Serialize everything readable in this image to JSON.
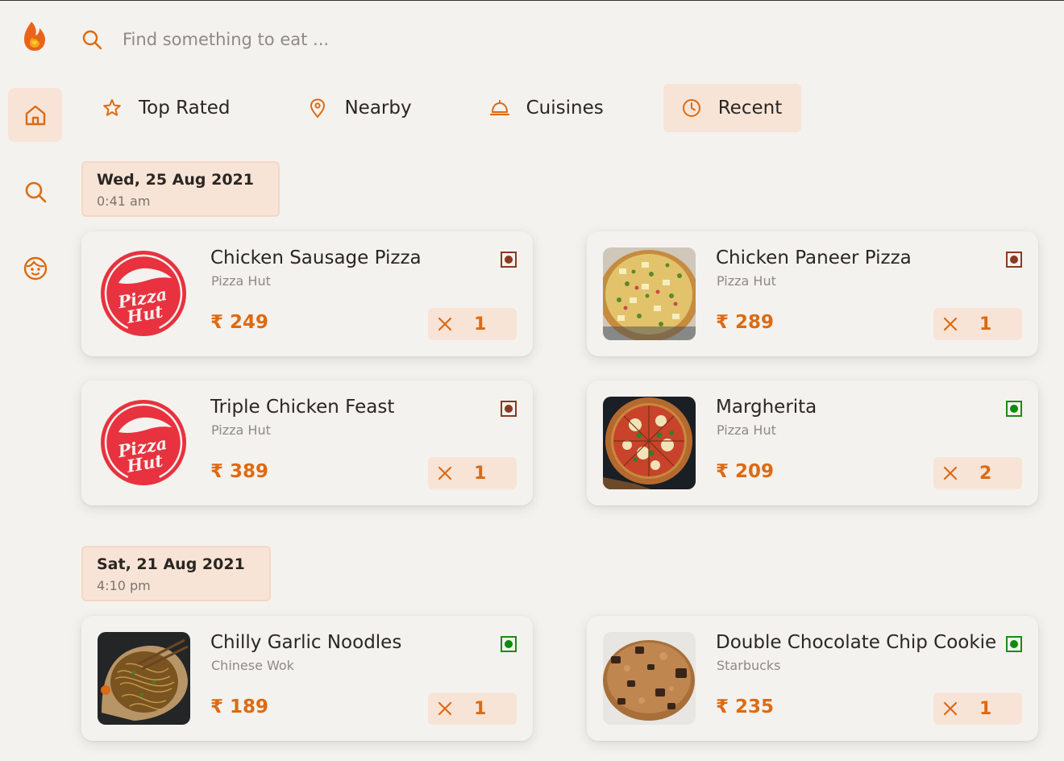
{
  "search": {
    "placeholder": "Find something to eat ..."
  },
  "tabs": [
    {
      "label": "Top Rated",
      "icon": "star-icon"
    },
    {
      "label": "Nearby",
      "icon": "location-pin-icon"
    },
    {
      "label": "Cuisines",
      "icon": "cloche-icon"
    },
    {
      "label": "Recent",
      "icon": "clock-icon",
      "active": true
    }
  ],
  "sidebar": [
    {
      "icon": "home-icon",
      "active": true
    },
    {
      "icon": "search-icon"
    },
    {
      "icon": "face-icon"
    }
  ],
  "currency": "₹",
  "groups": [
    {
      "date": "Wed, 25 Aug 2021",
      "time": "0:41 am",
      "items": [
        {
          "name": "Chicken Sausage Pizza",
          "restaurant": "Pizza Hut",
          "price": "₹ 249",
          "qty": "1",
          "veg": false,
          "image": "pizza-hut-logo"
        },
        {
          "name": "Chicken Paneer Pizza",
          "restaurant": "Pizza Hut",
          "price": "₹ 289",
          "qty": "1",
          "veg": false,
          "image": "paneer-pizza-photo"
        },
        {
          "name": "Triple Chicken Feast",
          "restaurant": "Pizza Hut",
          "price": "₹ 389",
          "qty": "1",
          "veg": false,
          "image": "pizza-hut-logo"
        },
        {
          "name": "Margherita",
          "restaurant": "Pizza Hut",
          "price": "₹ 209",
          "qty": "2",
          "veg": true,
          "image": "margherita-photo"
        }
      ]
    },
    {
      "date": "Sat, 21 Aug 2021",
      "time": "4:10 pm",
      "items": [
        {
          "name": "Chilly Garlic Noodles",
          "restaurant": "Chinese Wok",
          "price": "₹ 189",
          "qty": "1",
          "veg": true,
          "image": "noodles-photo"
        },
        {
          "name": "Double Chocolate Chip Cookie",
          "restaurant": "Starbucks",
          "price": "₹ 235",
          "qty": "1",
          "veg": true,
          "image": "cookie-photo"
        }
      ]
    }
  ],
  "colors": {
    "accent": "#dd6a12",
    "accent_soft": "#f8e4d7",
    "background": "#f4f2ee",
    "nonveg": "#8a3a22",
    "veg": "#0f8a0f"
  }
}
